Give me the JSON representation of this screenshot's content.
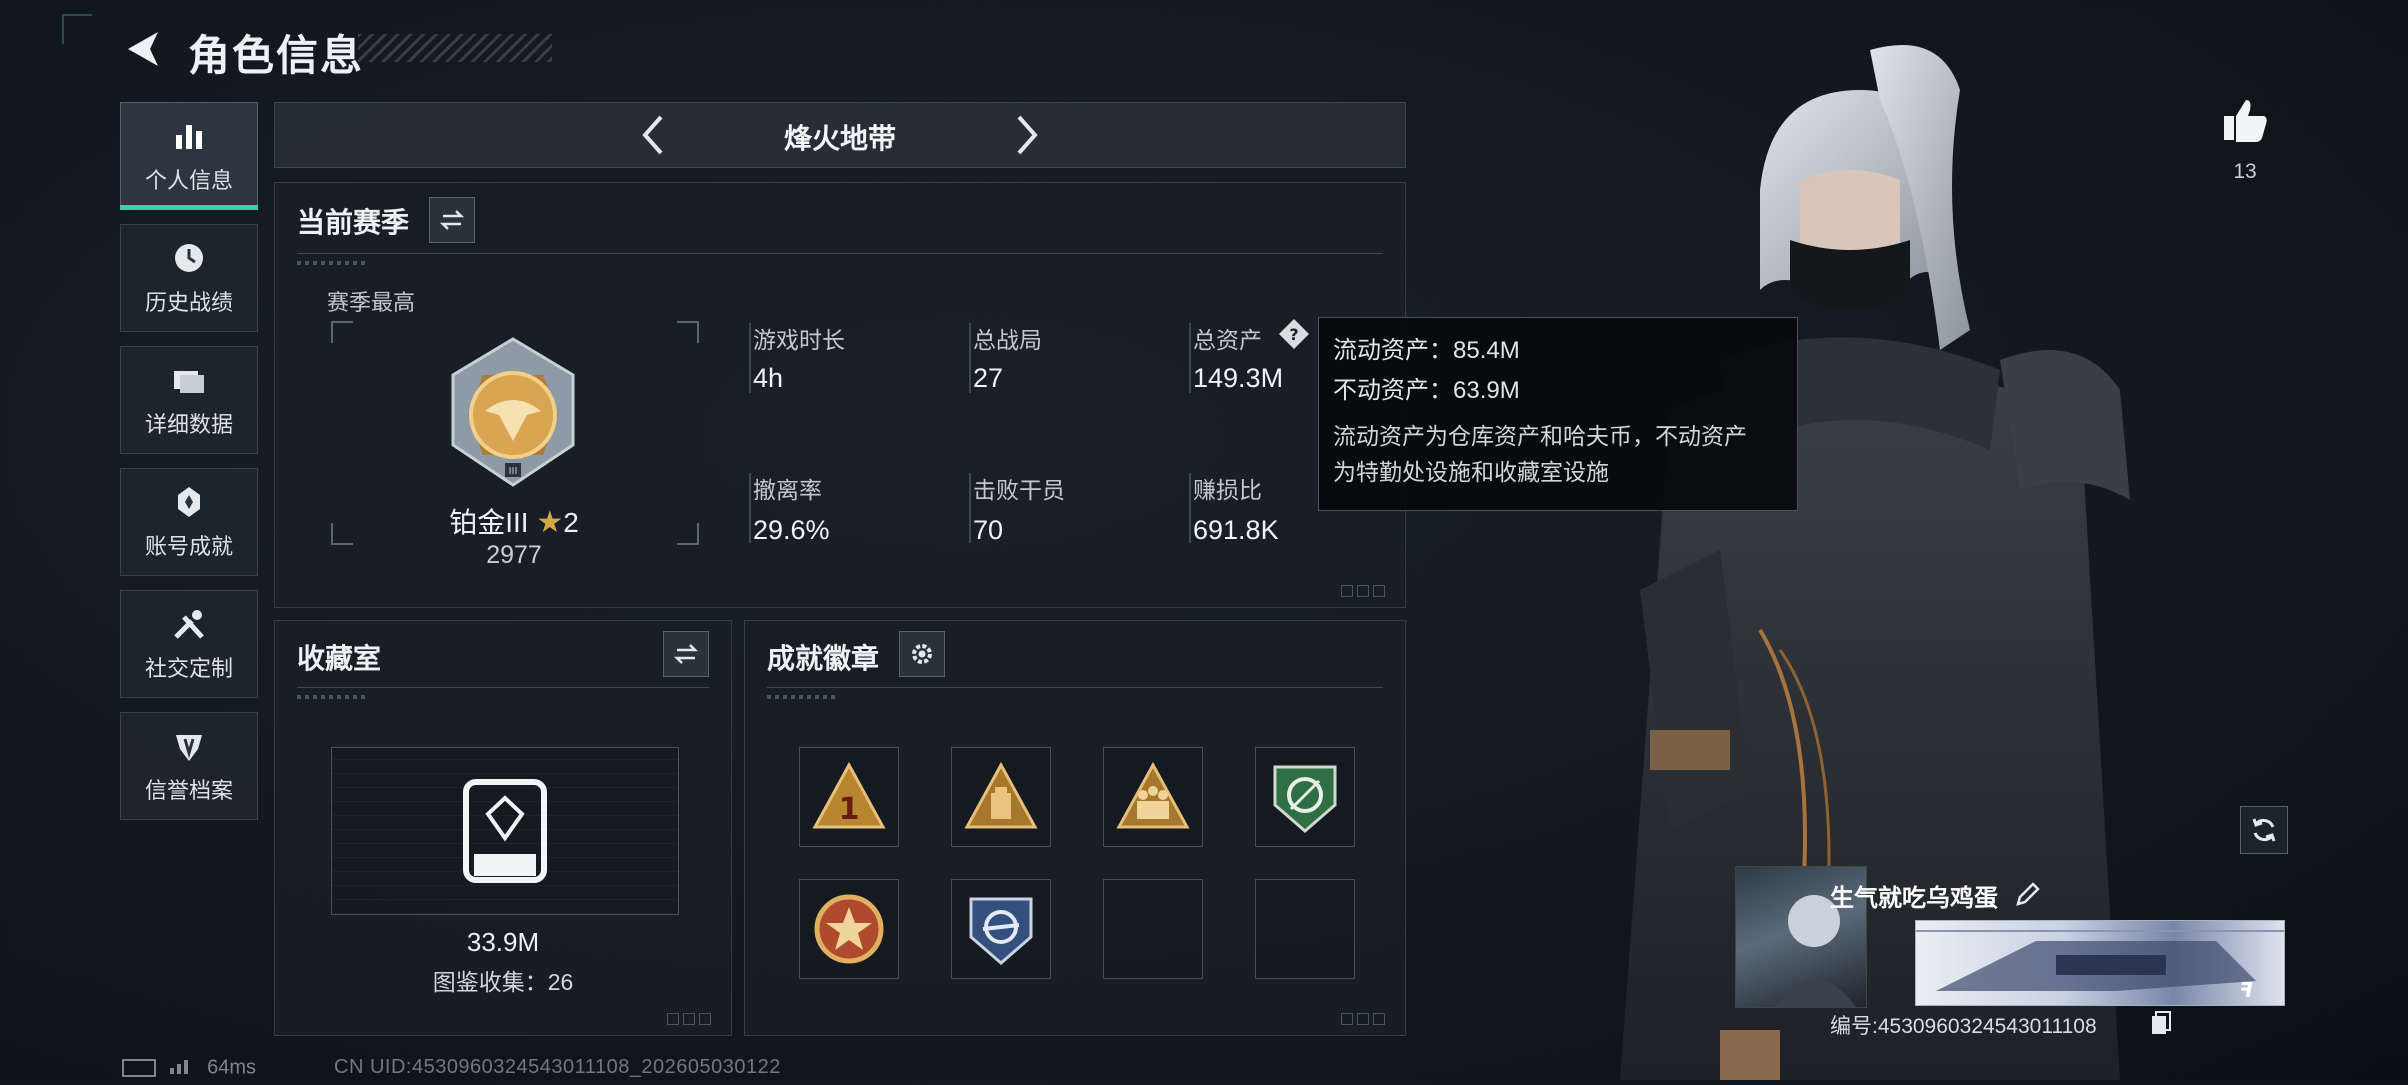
{
  "header": {
    "title": "角色信息"
  },
  "sidebar": {
    "items": [
      {
        "label": "个人信息",
        "icon": "bar-chart-icon",
        "active": true
      },
      {
        "label": "历史战绩",
        "icon": "clock-icon",
        "active": false
      },
      {
        "label": "详细数据",
        "icon": "folder-icon",
        "active": false
      },
      {
        "label": "账号成就",
        "icon": "achievement-icon",
        "active": false
      },
      {
        "label": "社交定制",
        "icon": "tools-icon",
        "active": false
      },
      {
        "label": "信誉档案",
        "icon": "shield-icon",
        "active": false
      }
    ]
  },
  "mode_selector": {
    "label": "烽火地带"
  },
  "season": {
    "title": "当前赛季",
    "best_label": "赛季最高",
    "rank_name": "铂金III",
    "rank_stars": "2",
    "rank_score": "2977",
    "stats": [
      {
        "label": "游戏时长",
        "value": "4h"
      },
      {
        "label": "总战局",
        "value": "27"
      },
      {
        "label": "总资产",
        "value": "149.3M"
      },
      {
        "label": "撤离率",
        "value": "29.6%"
      },
      {
        "label": "击败干员",
        "value": "70"
      },
      {
        "label": "赚损比",
        "value": "691.8K"
      }
    ]
  },
  "tooltip": {
    "liquid": "流动资产：85.4M",
    "fixed": "不动资产：63.9M",
    "desc_line1": "流动资产为仓库资产和哈夫币，不动资产",
    "desc_line2": "为特勤处设施和收藏室设施"
  },
  "collection": {
    "title": "收藏室",
    "value": "33.9M",
    "count_label": "图鉴收集：26"
  },
  "badges": {
    "title": "成就徽章",
    "slots": [
      {
        "icon": "rank-one-badge-icon",
        "color": "#b8862f"
      },
      {
        "icon": "supply-badge-icon",
        "color": "#b8862f"
      },
      {
        "icon": "squad-badge-icon",
        "color": "#b8862f"
      },
      {
        "icon": "target-shield-badge-icon",
        "color": "#3d8a52"
      },
      {
        "icon": "star-medal-badge-icon",
        "color": "#b04a2c"
      },
      {
        "icon": "blue-shield-badge-icon",
        "color": "#4d6fa8"
      },
      {
        "icon": "empty-slot",
        "color": ""
      },
      {
        "icon": "empty-slot",
        "color": ""
      }
    ]
  },
  "likes": {
    "count": "13"
  },
  "name_card": {
    "name": "生气就吃乌鸡蛋",
    "id_text": "编号:4530960324543011108"
  },
  "status": {
    "ping": "64ms",
    "uid": "CN UID:4530960324543011108_202605030122"
  }
}
